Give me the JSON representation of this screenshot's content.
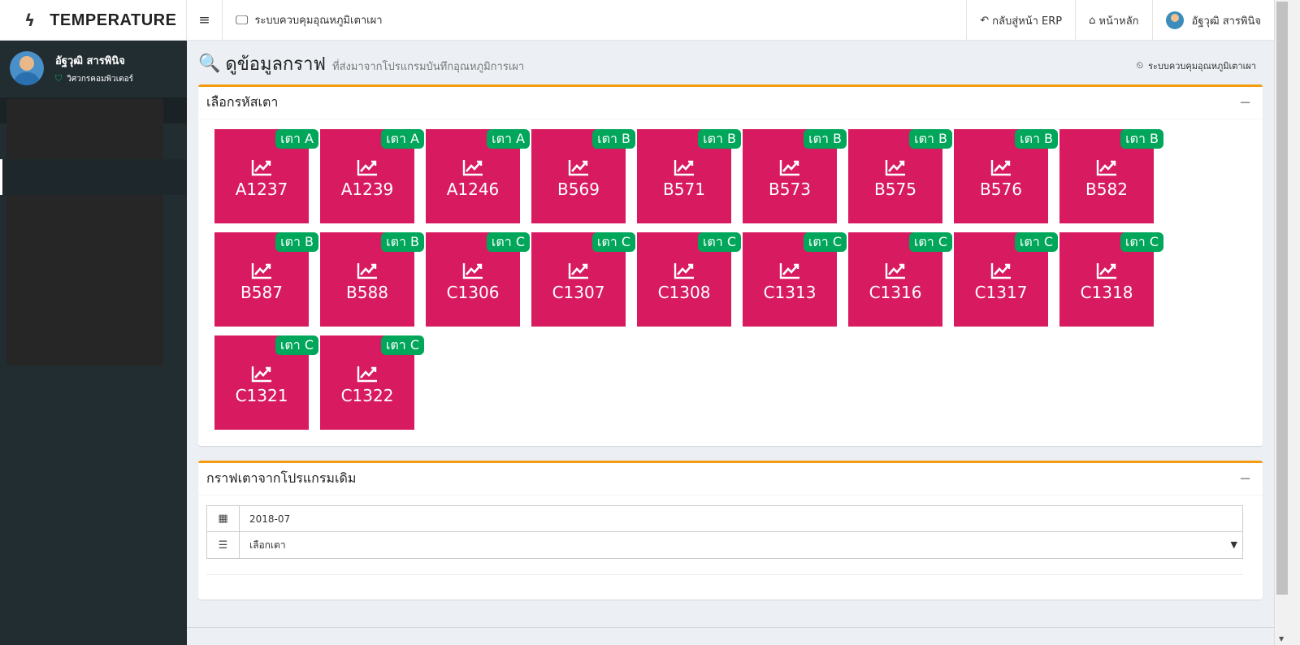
{
  "brand": {
    "name": "TEMPERATURE",
    "icon": "bolt-icon"
  },
  "topbar": {
    "menu_icon": "bars-icon",
    "system_title": "ระบบควบคุมอุณหภูมิเตาเผา",
    "back_erp": "กลับสู่หน้า ERP",
    "home": "หน้าหลัก",
    "user_name": "อัฐวุฒิ สารพินิจ"
  },
  "sidebar": {
    "user_name": "อัฐวุฒิ สารพินิจ",
    "user_role": "วิศวกรคอมพิวเตอร์"
  },
  "header": {
    "title": "ดูข้อมูลกราฟ",
    "subtitle": "ที่ส่งมาจากโปรแกรมบันทึกอุณหภูมิการเผา",
    "breadcrumb": "ระบบควบคุมอุณหภูมิเตาเผา"
  },
  "kiln_box": {
    "title": "เลือกรหัสเตา",
    "collapse": "−",
    "tiles": [
      {
        "code": "A1237",
        "badge": "เตา A"
      },
      {
        "code": "A1239",
        "badge": "เตา A"
      },
      {
        "code": "A1246",
        "badge": "เตา A"
      },
      {
        "code": "B569",
        "badge": "เตา B"
      },
      {
        "code": "B571",
        "badge": "เตา B"
      },
      {
        "code": "B573",
        "badge": "เตา B"
      },
      {
        "code": "B575",
        "badge": "เตา B"
      },
      {
        "code": "B576",
        "badge": "เตา B"
      },
      {
        "code": "B582",
        "badge": "เตา B"
      },
      {
        "code": "B587",
        "badge": "เตา B"
      },
      {
        "code": "B588",
        "badge": "เตา B"
      },
      {
        "code": "C1306",
        "badge": "เตา C"
      },
      {
        "code": "C1307",
        "badge": "เตา C"
      },
      {
        "code": "C1308",
        "badge": "เตา C"
      },
      {
        "code": "C1313",
        "badge": "เตา C"
      },
      {
        "code": "C1316",
        "badge": "เตา C"
      },
      {
        "code": "C1317",
        "badge": "เตา C"
      },
      {
        "code": "C1318",
        "badge": "เตา C"
      },
      {
        "code": "C1321",
        "badge": "เตา C"
      },
      {
        "code": "C1322",
        "badge": "เตา C"
      }
    ]
  },
  "legacy_box": {
    "title": "กราฟเตาจากโปรแกรมเดิม",
    "collapse": "−",
    "month_value": "2018-07",
    "kiln_select": "เลือกเตา"
  },
  "colors": {
    "tile": "#d81b60",
    "badge": "#00a65a",
    "accent": "#f39c12",
    "sidebar": "#222d32"
  }
}
